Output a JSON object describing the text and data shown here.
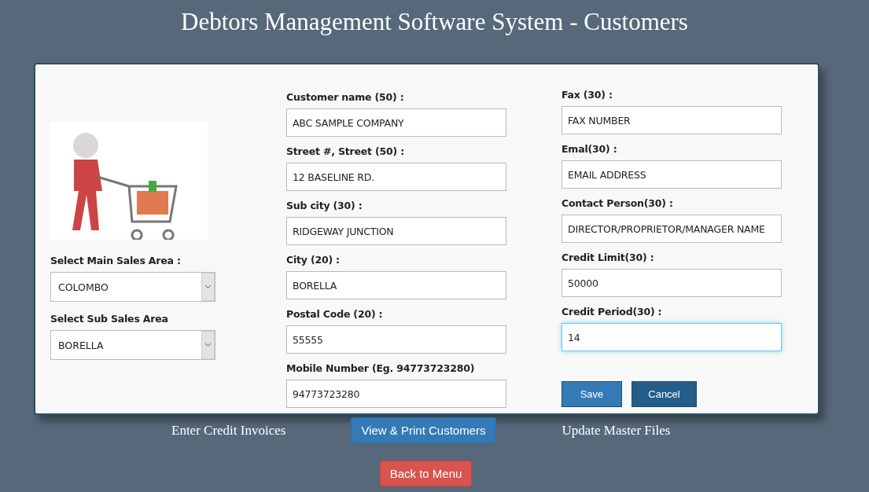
{
  "title": "Debtors Management Software System - Customers",
  "area_selects": [
    {
      "label": "Select Main Sales Area :",
      "value": "COLOMBO"
    },
    {
      "label": "Select Sub Sales Area",
      "value": "BORELLA"
    }
  ],
  "fields_left": [
    {
      "label": "Customer name (50) :",
      "value": "ABC SAMPLE COMPANY",
      "focused": false
    },
    {
      "label": "Street #, Street (50) :",
      "value": "12 BASELINE RD.",
      "focused": false
    },
    {
      "label": "Sub city (30) :",
      "value": "RIDGEWAY JUNCTION",
      "focused": false
    },
    {
      "label": "City (20) :",
      "value": "BORELLA",
      "focused": false
    },
    {
      "label": "Postal Code (20) :",
      "value": "55555",
      "focused": false
    },
    {
      "label": "Mobile Number (Eg. 94773723280)",
      "value": "94773723280",
      "focused": false
    }
  ],
  "fields_right": [
    {
      "label": "Fax (30) :",
      "value": "FAX NUMBER",
      "focused": false
    },
    {
      "label": "Emal(30) :",
      "value": "EMAIL ADDRESS",
      "focused": false
    },
    {
      "label": "Contact Person(30) :",
      "value": "DIRECTOR/PROPRIETOR/MANAGER NAME",
      "focused": false
    },
    {
      "label": "Credit Limit(30) :",
      "value": "50000",
      "focused": false
    },
    {
      "label": "Credit Period(30) :",
      "value": "14",
      "focused": true
    }
  ],
  "form_buttons": [
    {
      "label": "Save",
      "kind": "primary"
    },
    {
      "label": "Cancel",
      "kind": "dark"
    }
  ],
  "nav": [
    {
      "label": "Enter Credit Invoices",
      "kind": "link"
    },
    {
      "label": "View & Print Customers",
      "kind": "button"
    },
    {
      "label": "Update Master Files",
      "kind": "link"
    }
  ],
  "back_button": "Back to Menu"
}
